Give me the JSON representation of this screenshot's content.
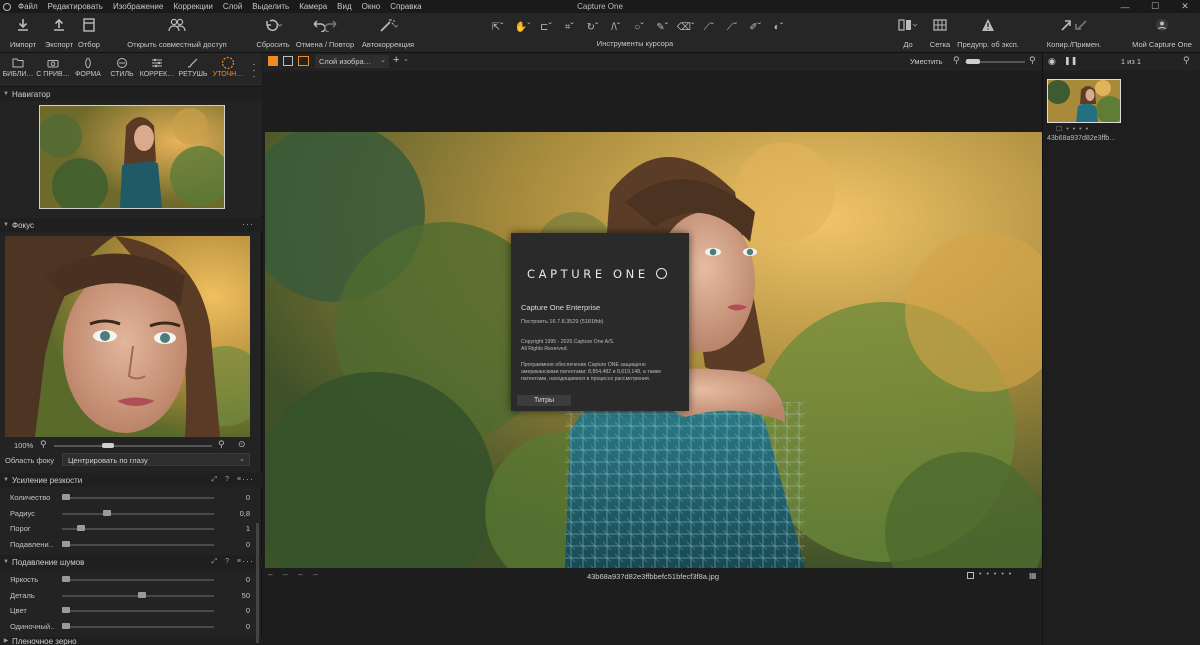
{
  "app": {
    "title": "Capture One"
  },
  "menu": [
    "Файл",
    "Редактировать",
    "Изображение",
    "Коррекции",
    "Слой",
    "Выделить",
    "Камера",
    "Вид",
    "Окно",
    "Справка"
  ],
  "toolbar": {
    "import": "Импорт",
    "export": "Экспорт",
    "select": "Отбор",
    "share": "Открыть совместный доступ",
    "reset": "Сбросить",
    "undo_redo": "Отмена / Повтор",
    "autocorrect": "Автокоррекция",
    "cursor_tools": "Инструменты курсора",
    "before": "До",
    "grid": "Сетка",
    "exposure_warning": "Предупр. об эксп.",
    "copy_apply": "Копир./Примен.",
    "my_capture_one": "Мой Capture One"
  },
  "tool_tabs": [
    {
      "label": "БИБЛИ…",
      "icon": "folder-icon"
    },
    {
      "label": "С ПРИВ…",
      "icon": "camera-icon"
    },
    {
      "label": "ФОРМА",
      "icon": "lens-icon"
    },
    {
      "label": "СТИЛЬ",
      "icon": "palette-icon"
    },
    {
      "label": "КОРРЕК…",
      "icon": "sliders-icon"
    },
    {
      "label": "РЕТУШЬ",
      "icon": "brush-icon"
    },
    {
      "label": "УТОЧН…",
      "icon": "refine-icon",
      "active": true
    }
  ],
  "navigator": {
    "title": "Навигатор"
  },
  "focus": {
    "title": "Фокус",
    "zoom": "100%",
    "area_label": "Область фоку",
    "area_value": "Центрировать по глазу"
  },
  "sharpening": {
    "title": "Усиление резкости",
    "rows": [
      {
        "name": "Количество",
        "value": "0",
        "level": 0
      },
      {
        "name": "Радиус",
        "value": "0,8",
        "level": 0.27
      },
      {
        "name": "Порог",
        "value": "1",
        "level": 0.1
      },
      {
        "name": "Подавлени…",
        "value": "0",
        "level": 0
      }
    ]
  },
  "noise": {
    "title": "Подавление шумов",
    "rows": [
      {
        "name": "Яркость",
        "value": "0",
        "level": 0
      },
      {
        "name": "Деталь",
        "value": "50",
        "level": 0.5
      },
      {
        "name": "Цвет",
        "value": "0",
        "level": 0
      },
      {
        "name": "Одиночный…",
        "value": "0",
        "level": 0
      }
    ]
  },
  "next_panel": {
    "title": "Пленочное зерно"
  },
  "viewer": {
    "layer_select": "Слой изобра…",
    "fit_label": "Уместить",
    "filename": "43b68a937d82e3ffbbefc51bfecf3f8a.jpg",
    "meta": [
      "--",
      "--",
      "--",
      "--"
    ]
  },
  "about": {
    "logo": "CAPTURE ONE",
    "product": "Capture One Enterprise",
    "build": "Построить 16.7.8.3529 (5181fbb)",
    "copyright": "Copyright 1995 - 2026 Capture One A/S.",
    "rights": "All Rights Reserved.",
    "patent_1": "Программное обеспечение Capture ONE защищено американскими патентами: 8,854,482 и 8,619,148, а также",
    "patent_2": "патентами, находящимися в процессе рассмотрения.",
    "credits_button": "Титры"
  },
  "browser": {
    "count": "1 из 1",
    "thumb_name": "43b68a937d82e3ffb…"
  },
  "colors": {
    "accent": "#f08a24",
    "panel": "#232323",
    "toolbar": "#262626"
  }
}
